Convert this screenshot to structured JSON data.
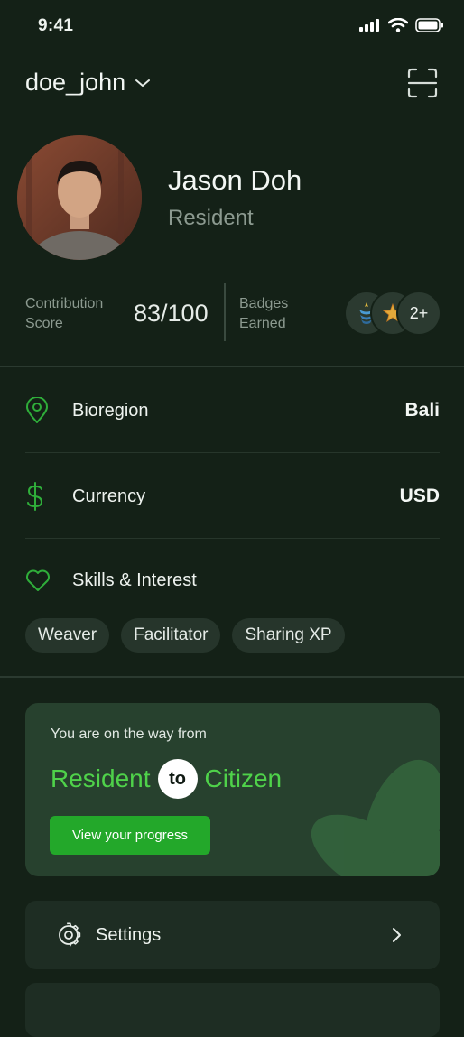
{
  "status_bar": {
    "time": "9:41"
  },
  "header": {
    "username": "doe_john"
  },
  "profile": {
    "name": "Jason Doh",
    "role": "Resident"
  },
  "stats": {
    "score_label": "Contribution Score",
    "score_value": "83/100",
    "badges_label": "Badges Earned",
    "badges_more": "2+"
  },
  "info": {
    "bioregion": {
      "label": "Bioregion",
      "value": "Bali"
    },
    "currency": {
      "label": "Currency",
      "value": "USD"
    },
    "skills": {
      "label": "Skills & Interest"
    }
  },
  "chips": [
    "Weaver",
    "Facilitator",
    "Sharing XP"
  ],
  "progress_card": {
    "subtitle": "You are on the way from",
    "from": "Resident",
    "to": "to",
    "target": "Citizen",
    "button": "View your progress"
  },
  "menu": {
    "settings": "Settings"
  },
  "colors": {
    "accent_green": "#4fd24a",
    "button_green": "#23a82a",
    "background": "#142117"
  }
}
